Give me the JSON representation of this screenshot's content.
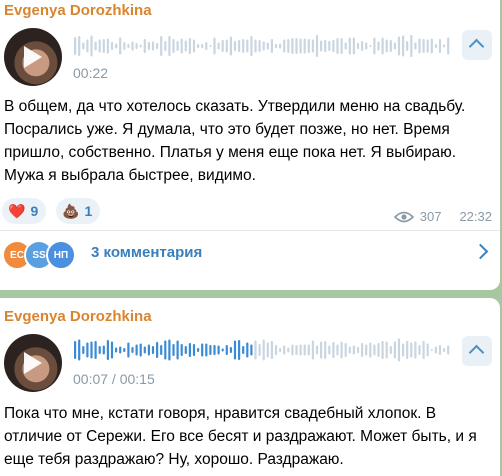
{
  "messages": [
    {
      "sender": "Evgenya Dorozhkina",
      "voice_time": "00:22",
      "voice_progress": 0,
      "text": "В общем, да что хотелось сказать. Утвердили меню на свадьбу. Посрались уже. Я думала, что это будет позже, но нет. Время пришло, собственно. Платья у меня еще пока нет. Я выбираю. Мужа я выбрала быстрее, видимо.",
      "reactions": [
        {
          "icon": "heart-icon",
          "emoji": "❤️",
          "count": "9"
        },
        {
          "icon": "poop-icon",
          "emoji": "💩",
          "count": "1"
        }
      ],
      "views": "307",
      "time": "22:32",
      "comments": {
        "avatars": [
          {
            "initials": "ЕС",
            "color": "#f08a3c"
          },
          {
            "initials": "SS",
            "color": "#5aa0e0"
          },
          {
            "initials": "НП",
            "color": "#4a8fe0"
          }
        ],
        "label": "3 комментария"
      }
    },
    {
      "sender": "Evgenya Dorozhkina",
      "voice_time": "00:07 / 00:15",
      "voice_progress": 0.47,
      "text": "Пока что мне, кстати говоря, нравится свадебный хлопок. В отличие от Сережи. Его все бесят и раздражают. Может быть, и я еще тебя раздражаю? Ну, хорошо. Раздражаю."
    }
  ],
  "colors": {
    "accent": "#3a7fbd",
    "sender": "#d9852e",
    "wave_played": "#3a8ad6",
    "wave_unplayed": "#c9d6e0",
    "background": "#a7c7a1"
  }
}
